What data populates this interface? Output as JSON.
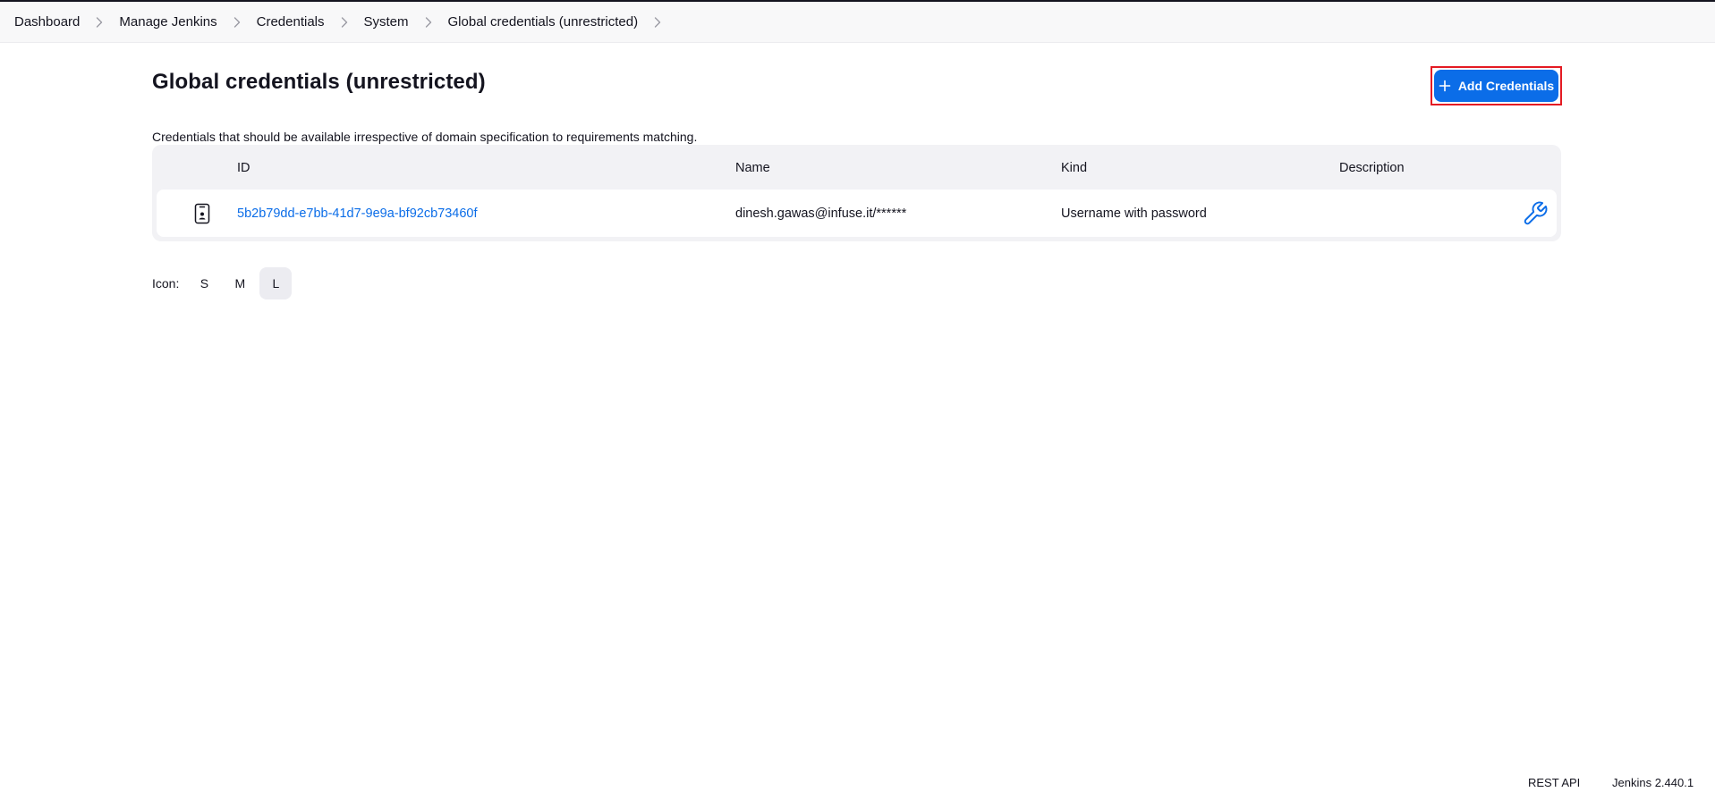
{
  "breadcrumbs": [
    {
      "label": "Dashboard"
    },
    {
      "label": "Manage Jenkins"
    },
    {
      "label": "Credentials"
    },
    {
      "label": "System"
    },
    {
      "label": "Global credentials (unrestricted)"
    }
  ],
  "page": {
    "title": "Global credentials (unrestricted)",
    "add_button_label": "Add Credentials",
    "description": "Credentials that should be available irrespective of domain specification to requirements matching."
  },
  "table": {
    "headers": {
      "id": "ID",
      "name": "Name",
      "kind": "Kind",
      "description": "Description"
    },
    "rows": [
      {
        "icon": "credential-badge-icon",
        "id": "5b2b79dd-e7bb-41d7-9e9a-bf92cb73460f",
        "name": "dinesh.gawas@infuse.it/******",
        "kind": "Username with password",
        "description": "",
        "action_icon": "wrench-icon"
      }
    ]
  },
  "icon_size": {
    "label": "Icon:",
    "options": [
      "S",
      "M",
      "L"
    ],
    "selected": "L"
  },
  "footer": {
    "rest_api": "REST API",
    "version": "Jenkins 2.440.1"
  },
  "colors": {
    "accent": "#0b6de8",
    "highlight_border": "#e41b23"
  }
}
